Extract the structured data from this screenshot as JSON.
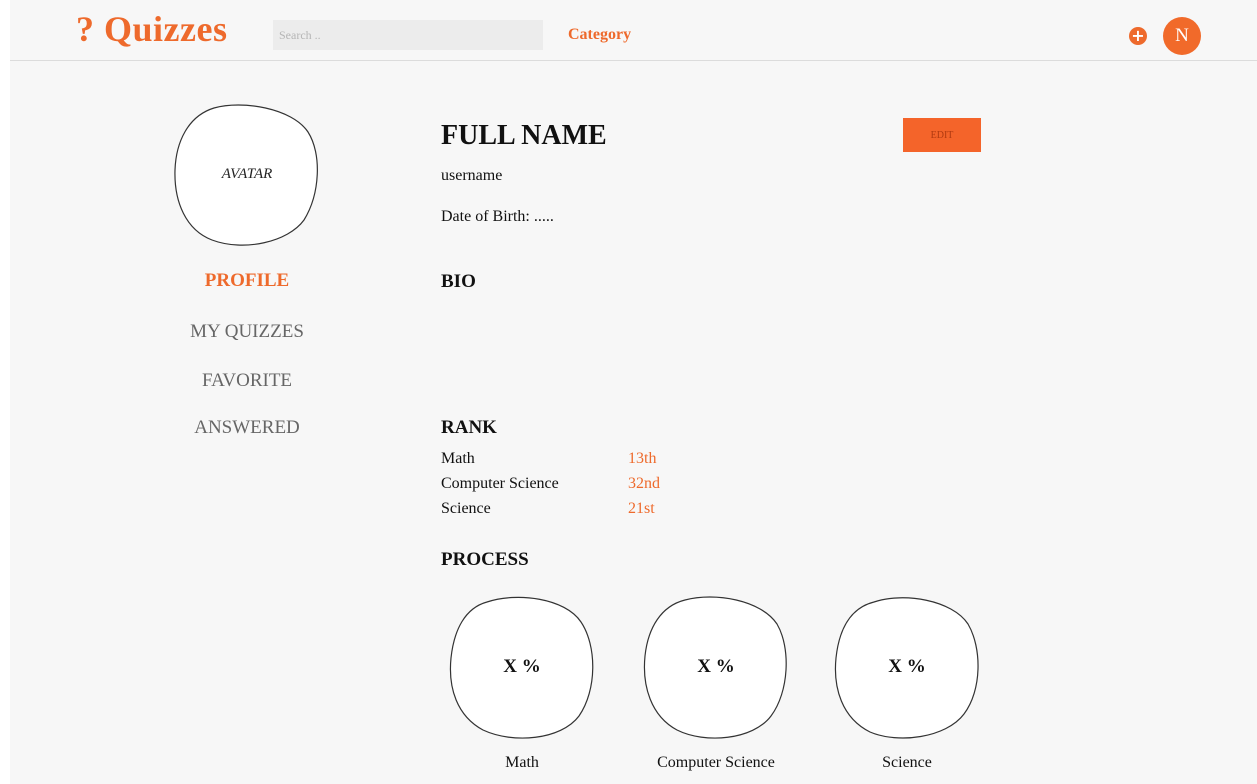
{
  "header": {
    "logo": "? Quizzes",
    "search_placeholder": "Search ..",
    "category_label": "Category",
    "add_icon": "+",
    "user_initial": "N"
  },
  "sidebar": {
    "avatar_label": "AVATAR",
    "items": [
      {
        "label": "PROFILE",
        "active": true
      },
      {
        "label": "MY QUIZZES",
        "active": false
      },
      {
        "label": "FAVORITE",
        "active": false
      },
      {
        "label": "ANSWERED",
        "active": false
      }
    ]
  },
  "profile": {
    "full_name": "FULL NAME",
    "edit_label": "EDIT",
    "username": "username",
    "dob": "Date of Birth: ....."
  },
  "bio": {
    "title": "BIO"
  },
  "rank": {
    "title": "RANK",
    "rows": [
      {
        "subject": "Math",
        "value": "13th"
      },
      {
        "subject": "Computer Science",
        "value": "32nd"
      },
      {
        "subject": "Science",
        "value": "21st"
      }
    ]
  },
  "process": {
    "title": "PROCESS",
    "items": [
      {
        "value": "X %",
        "label": "Math"
      },
      {
        "value": "X %",
        "label": "Computer Science"
      },
      {
        "value": "X %",
        "label": "Science"
      }
    ]
  },
  "colors": {
    "accent": "#ee6a2c",
    "background": "#f7f7f7"
  }
}
